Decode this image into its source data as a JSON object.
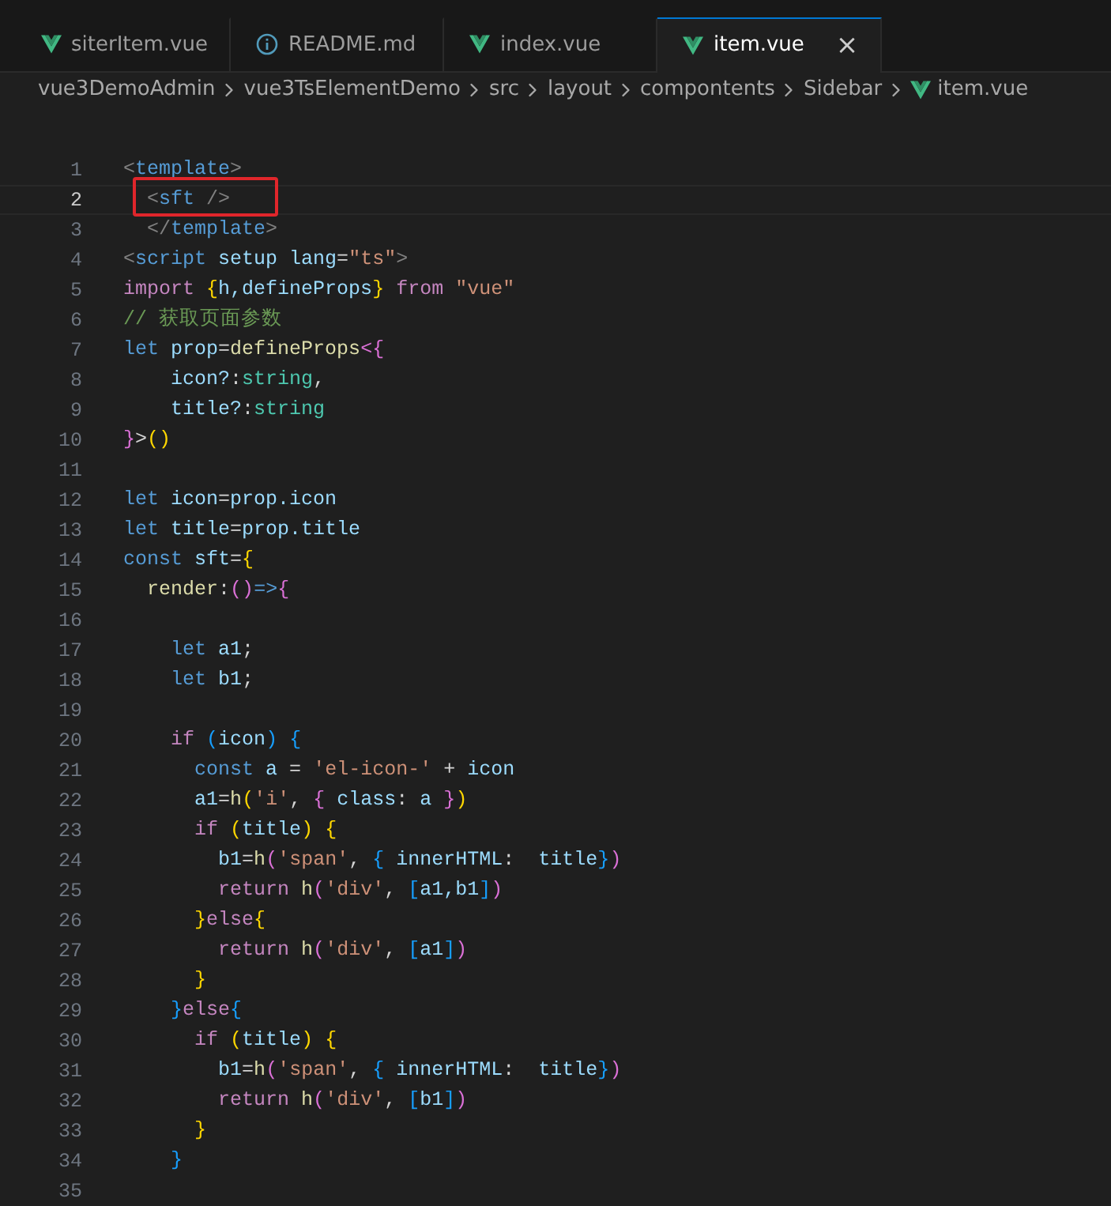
{
  "tabs": [
    {
      "label": "siterItem.vue",
      "kind": "vue",
      "selected": false
    },
    {
      "label": "README.md",
      "kind": "info",
      "selected": false
    },
    {
      "label": "index.vue",
      "kind": "vue",
      "selected": false
    },
    {
      "label": "item.vue",
      "kind": "vue",
      "selected": true,
      "close": "×"
    }
  ],
  "breadcrumb": [
    {
      "label": "vue3DemoAdmin"
    },
    {
      "label": "vue3TsElementDemo"
    },
    {
      "label": "src"
    },
    {
      "label": "layout"
    },
    {
      "label": "compontents"
    },
    {
      "label": "Sidebar"
    },
    {
      "label": "item.vue",
      "kind": "vue"
    }
  ],
  "editor": {
    "lines": [
      {
        "number": "1",
        "selected": false,
        "tokens": [
          {
            "text": "<",
            "kind": "punct"
          },
          {
            "text": "template",
            "kind": "tag"
          },
          {
            "text": ">",
            "kind": "punct"
          }
        ]
      },
      {
        "number": "2",
        "selected": true,
        "tokens": [
          {
            "text": "  <",
            "kind": "punct"
          },
          {
            "text": "sft",
            "kind": "tag"
          },
          {
            "text": " />",
            "kind": "punct"
          }
        ]
      },
      {
        "number": "3",
        "selected": false,
        "tokens": [
          {
            "text": "  </",
            "kind": "punct"
          },
          {
            "text": "template",
            "kind": "tag"
          },
          {
            "text": ">",
            "kind": "punct"
          }
        ]
      },
      {
        "number": "4",
        "selected": false,
        "tokens": [
          {
            "text": "<",
            "kind": "punct"
          },
          {
            "text": "script",
            "kind": "tag"
          },
          {
            "text": " setup lang",
            "kind": "var"
          },
          {
            "text": "=",
            "kind": "plain"
          },
          {
            "text": "\"ts\"",
            "kind": "string"
          },
          {
            "text": ">",
            "kind": "punct"
          }
        ]
      },
      {
        "number": "5",
        "selected": false,
        "tokens": [
          {
            "text": "import",
            "kind": "control"
          },
          {
            "text": " {",
            "kind": "b1"
          },
          {
            "text": "h,defineProps",
            "kind": "var"
          },
          {
            "text": "}",
            "kind": "b1"
          },
          {
            "text": " from",
            "kind": "control"
          },
          {
            "text": " \"vue\"",
            "kind": "string"
          }
        ]
      },
      {
        "number": "6",
        "selected": false,
        "tokens": [
          {
            "text": "// 获取页面参数",
            "kind": "comment"
          }
        ]
      },
      {
        "number": "7",
        "selected": false,
        "tokens": [
          {
            "text": "let",
            "kind": "keyword"
          },
          {
            "text": " prop",
            "kind": "var"
          },
          {
            "text": "=",
            "kind": "plain"
          },
          {
            "text": "defineProps",
            "kind": "func"
          },
          {
            "text": "<{",
            "kind": "b2"
          }
        ]
      },
      {
        "number": "8",
        "selected": false,
        "tokens": [
          {
            "text": "    icon?",
            "kind": "var"
          },
          {
            "text": ":",
            "kind": "plain"
          },
          {
            "text": "string",
            "kind": "type"
          },
          {
            "text": ",",
            "kind": "plain"
          }
        ]
      },
      {
        "number": "9",
        "selected": false,
        "tokens": [
          {
            "text": "    title?",
            "kind": "var"
          },
          {
            "text": ":",
            "kind": "plain"
          },
          {
            "text": "string",
            "kind": "type"
          }
        ]
      },
      {
        "number": "10",
        "selected": false,
        "tokens": [
          {
            "text": "}",
            "kind": "b2"
          },
          {
            "text": ">",
            "kind": "plain"
          },
          {
            "text": "()",
            "kind": "b1"
          }
        ]
      },
      {
        "number": "11",
        "selected": false
      },
      {
        "number": "12",
        "selected": false,
        "tokens": [
          {
            "text": "let",
            "kind": "keyword"
          },
          {
            "text": " icon",
            "kind": "var"
          },
          {
            "text": "=",
            "kind": "plain"
          },
          {
            "text": "prop.icon",
            "kind": "var"
          }
        ]
      },
      {
        "number": "13",
        "selected": false,
        "tokens": [
          {
            "text": "let",
            "kind": "keyword"
          },
          {
            "text": " title",
            "kind": "var"
          },
          {
            "text": "=",
            "kind": "plain"
          },
          {
            "text": "prop.title",
            "kind": "var"
          }
        ]
      },
      {
        "number": "14",
        "selected": false,
        "tokens": [
          {
            "text": "const",
            "kind": "keyword"
          },
          {
            "text": " sft",
            "kind": "var"
          },
          {
            "text": "=",
            "kind": "plain"
          },
          {
            "text": "{",
            "kind": "b1"
          }
        ]
      },
      {
        "number": "15",
        "selected": false,
        "tokens": [
          {
            "text": "  render",
            "kind": "func"
          },
          {
            "text": ":",
            "kind": "plain"
          },
          {
            "text": "()",
            "kind": "b2"
          },
          {
            "text": "=>",
            "kind": "keyword"
          },
          {
            "text": "{",
            "kind": "b2"
          }
        ]
      },
      {
        "number": "16",
        "selected": false
      },
      {
        "number": "17",
        "selected": false,
        "tokens": [
          {
            "text": "    let",
            "kind": "keyword"
          },
          {
            "text": " a1",
            "kind": "var"
          },
          {
            "text": ";",
            "kind": "plain"
          }
        ]
      },
      {
        "number": "18",
        "selected": false,
        "tokens": [
          {
            "text": "    let",
            "kind": "keyword"
          },
          {
            "text": " b1",
            "kind": "var"
          },
          {
            "text": ";",
            "kind": "plain"
          }
        ]
      },
      {
        "number": "19",
        "selected": false
      },
      {
        "number": "20",
        "selected": false,
        "tokens": [
          {
            "text": "    if",
            "kind": "control"
          },
          {
            "text": " (",
            "kind": "b3"
          },
          {
            "text": "icon",
            "kind": "var"
          },
          {
            "text": ")",
            "kind": "b3"
          },
          {
            "text": " {",
            "kind": "b3"
          }
        ]
      },
      {
        "number": "21",
        "selected": false,
        "tokens": [
          {
            "text": "      const",
            "kind": "keyword"
          },
          {
            "text": " a",
            "kind": "var"
          },
          {
            "text": " = ",
            "kind": "plain"
          },
          {
            "text": "'el-icon-'",
            "kind": "string"
          },
          {
            "text": " + ",
            "kind": "plain"
          },
          {
            "text": "icon",
            "kind": "var"
          }
        ]
      },
      {
        "number": "22",
        "selected": false,
        "tokens": [
          {
            "text": "      a1",
            "kind": "var"
          },
          {
            "text": "=",
            "kind": "plain"
          },
          {
            "text": "h",
            "kind": "func"
          },
          {
            "text": "(",
            "kind": "b1"
          },
          {
            "text": "'i'",
            "kind": "string"
          },
          {
            "text": ", ",
            "kind": "plain"
          },
          {
            "text": "{",
            "kind": "b2"
          },
          {
            "text": " class",
            "kind": "var"
          },
          {
            "text": ": ",
            "kind": "plain"
          },
          {
            "text": "a",
            "kind": "var"
          },
          {
            "text": " }",
            "kind": "b2"
          },
          {
            "text": ")",
            "kind": "b1"
          }
        ]
      },
      {
        "number": "23",
        "selected": false,
        "tokens": [
          {
            "text": "      if",
            "kind": "control"
          },
          {
            "text": " (",
            "kind": "b1"
          },
          {
            "text": "title",
            "kind": "var"
          },
          {
            "text": ")",
            "kind": "b1"
          },
          {
            "text": " {",
            "kind": "b1"
          }
        ]
      },
      {
        "number": "24",
        "selected": false,
        "tokens": [
          {
            "text": "        b1",
            "kind": "var"
          },
          {
            "text": "=",
            "kind": "plain"
          },
          {
            "text": "h",
            "kind": "func"
          },
          {
            "text": "(",
            "kind": "b2"
          },
          {
            "text": "'span'",
            "kind": "string"
          },
          {
            "text": ", ",
            "kind": "plain"
          },
          {
            "text": "{",
            "kind": "b3"
          },
          {
            "text": " innerHTML",
            "kind": "var"
          },
          {
            "text": ":  ",
            "kind": "plain"
          },
          {
            "text": "title",
            "kind": "var"
          },
          {
            "text": "}",
            "kind": "b3"
          },
          {
            "text": ")",
            "kind": "b2"
          }
        ]
      },
      {
        "number": "25",
        "selected": false,
        "tokens": [
          {
            "text": "        return",
            "kind": "control"
          },
          {
            "text": " h",
            "kind": "func"
          },
          {
            "text": "(",
            "kind": "b2"
          },
          {
            "text": "'div'",
            "kind": "string"
          },
          {
            "text": ", ",
            "kind": "plain"
          },
          {
            "text": "[",
            "kind": "b3"
          },
          {
            "text": "a1,b1",
            "kind": "var"
          },
          {
            "text": "]",
            "kind": "b3"
          },
          {
            "text": ")",
            "kind": "b2"
          }
        ]
      },
      {
        "number": "26",
        "selected": false,
        "tokens": [
          {
            "text": "      }",
            "kind": "b1"
          },
          {
            "text": "else",
            "kind": "control"
          },
          {
            "text": "{",
            "kind": "b1"
          }
        ]
      },
      {
        "number": "27",
        "selected": false,
        "tokens": [
          {
            "text": "        return",
            "kind": "control"
          },
          {
            "text": " h",
            "kind": "func"
          },
          {
            "text": "(",
            "kind": "b2"
          },
          {
            "text": "'div'",
            "kind": "string"
          },
          {
            "text": ", ",
            "kind": "plain"
          },
          {
            "text": "[",
            "kind": "b3"
          },
          {
            "text": "a1",
            "kind": "var"
          },
          {
            "text": "]",
            "kind": "b3"
          },
          {
            "text": ")",
            "kind": "b2"
          }
        ]
      },
      {
        "number": "28",
        "selected": false,
        "tokens": [
          {
            "text": "      }",
            "kind": "b1"
          }
        ]
      },
      {
        "number": "29",
        "selected": false,
        "tokens": [
          {
            "text": "    }",
            "kind": "b3"
          },
          {
            "text": "else",
            "kind": "control"
          },
          {
            "text": "{",
            "kind": "b3"
          }
        ]
      },
      {
        "number": "30",
        "selected": false,
        "tokens": [
          {
            "text": "      if",
            "kind": "control"
          },
          {
            "text": " (",
            "kind": "b1"
          },
          {
            "text": "title",
            "kind": "var"
          },
          {
            "text": ")",
            "kind": "b1"
          },
          {
            "text": " {",
            "kind": "b1"
          }
        ]
      },
      {
        "number": "31",
        "selected": false,
        "tokens": [
          {
            "text": "        b1",
            "kind": "var"
          },
          {
            "text": "=",
            "kind": "plain"
          },
          {
            "text": "h",
            "kind": "func"
          },
          {
            "text": "(",
            "kind": "b2"
          },
          {
            "text": "'span'",
            "kind": "string"
          },
          {
            "text": ", ",
            "kind": "plain"
          },
          {
            "text": "{",
            "kind": "b3"
          },
          {
            "text": " innerHTML",
            "kind": "var"
          },
          {
            "text": ":  ",
            "kind": "plain"
          },
          {
            "text": "title",
            "kind": "var"
          },
          {
            "text": "}",
            "kind": "b3"
          },
          {
            "text": ")",
            "kind": "b2"
          }
        ]
      },
      {
        "number": "32",
        "selected": false,
        "tokens": [
          {
            "text": "        return",
            "kind": "control"
          },
          {
            "text": " h",
            "kind": "func"
          },
          {
            "text": "(",
            "kind": "b2"
          },
          {
            "text": "'div'",
            "kind": "string"
          },
          {
            "text": ", ",
            "kind": "plain"
          },
          {
            "text": "[",
            "kind": "b3"
          },
          {
            "text": "b1",
            "kind": "var"
          },
          {
            "text": "]",
            "kind": "b3"
          },
          {
            "text": ")",
            "kind": "b2"
          }
        ]
      },
      {
        "number": "33",
        "selected": false,
        "tokens": [
          {
            "text": "      }",
            "kind": "b1"
          }
        ]
      },
      {
        "number": "34",
        "selected": false,
        "tokens": [
          {
            "text": "    }",
            "kind": "b3"
          }
        ]
      },
      {
        "number": "35",
        "selected": false
      }
    ]
  }
}
